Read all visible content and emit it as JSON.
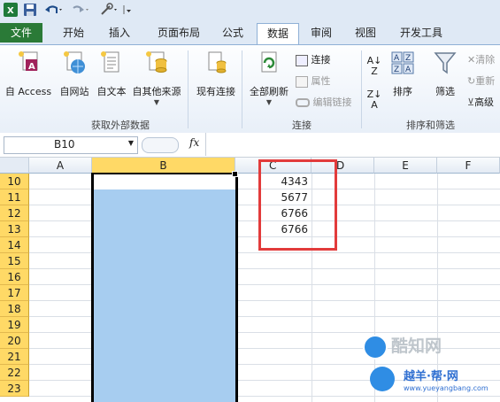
{
  "ribbon_tabs": {
    "file": "文件",
    "home": "开始",
    "insert": "插入",
    "page_layout": "页面布局",
    "formulas": "公式",
    "data": "数据",
    "review": "审阅",
    "view": "视图",
    "developer": "开发工具"
  },
  "get_external": {
    "access": "自 Access",
    "web": "自网站",
    "text": "自文本",
    "other": "自其他来源",
    "existing": "现有连接",
    "group_label": "获取外部数据"
  },
  "connections": {
    "refresh_all": "全部刷新",
    "connections": "连接",
    "properties": "属性",
    "edit_links": "编辑链接",
    "group_label": "连接"
  },
  "sort_filter": {
    "sort": "排序",
    "filter": "筛选",
    "clear": "清除",
    "reapply": "重新",
    "advanced": "高级",
    "group_label": "排序和筛选"
  },
  "formula_bar": {
    "name_box": "B10",
    "fx": "fx"
  },
  "columns": [
    "A",
    "B",
    "C",
    "D",
    "E",
    "F"
  ],
  "rows": [
    "10",
    "11",
    "12",
    "13",
    "14",
    "15",
    "16",
    "17",
    "18",
    "19",
    "20",
    "21",
    "22",
    "23"
  ],
  "column_c_values": [
    "4343",
    "5677",
    "6766",
    "6766"
  ],
  "watermark": {
    "title": "酷知网",
    "subtitle": "越羊·帮·网",
    "url": "www.yueyangbang.com"
  }
}
